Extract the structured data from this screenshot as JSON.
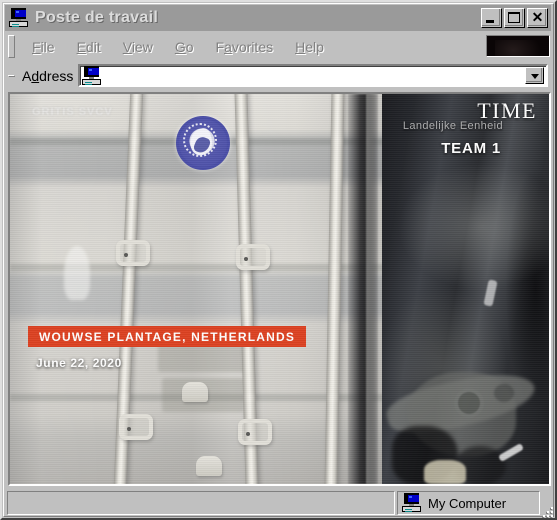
{
  "window": {
    "title": "Poste de travail",
    "icon": "my-computer-icon",
    "controls": {
      "minimize_label": "_",
      "maximize_label": "□",
      "close_label": "✕"
    }
  },
  "menubar": {
    "items": [
      {
        "label": "File",
        "accel": "F"
      },
      {
        "label": "Edit",
        "accel": "E"
      },
      {
        "label": "View",
        "accel": "V"
      },
      {
        "label": "Go",
        "accel": "G"
      },
      {
        "label": "Favorites",
        "accel": "a"
      },
      {
        "label": "Help",
        "accel": "H"
      }
    ],
    "brand_logo": "internet-explorer-logo"
  },
  "addressbar": {
    "label": "Address",
    "label_accel": "d",
    "value": "",
    "placeholder": "",
    "icon": "my-computer-icon",
    "dropdown_icon": "chevron-down-icon"
  },
  "content": {
    "type": "video-still",
    "watermark": "GRITIS SVCV",
    "brand": "TIME",
    "overlay_sub": "Landelijke Eenheid",
    "overlay_main": "TEAM 1",
    "caption_location": "WOUWSE PLANTAGE, NETHERLANDS",
    "caption_date": "June 22, 2020",
    "seal": "customs-seal-badge",
    "colors": {
      "caption_banner": "#dd4222",
      "container_wall": "#d8d6d1",
      "dark_region": "#24262b",
      "overlay_text": "#ffffff"
    }
  },
  "statusbar": {
    "left_text": "",
    "zone_text": "My Computer",
    "zone_icon": "my-computer-icon"
  },
  "theme": {
    "face": "#c0c0c0",
    "titlebar_inactive": "#9a9a9a",
    "titlebar_text": "#dcdcdc",
    "menu_disabled_text": "#808080"
  }
}
